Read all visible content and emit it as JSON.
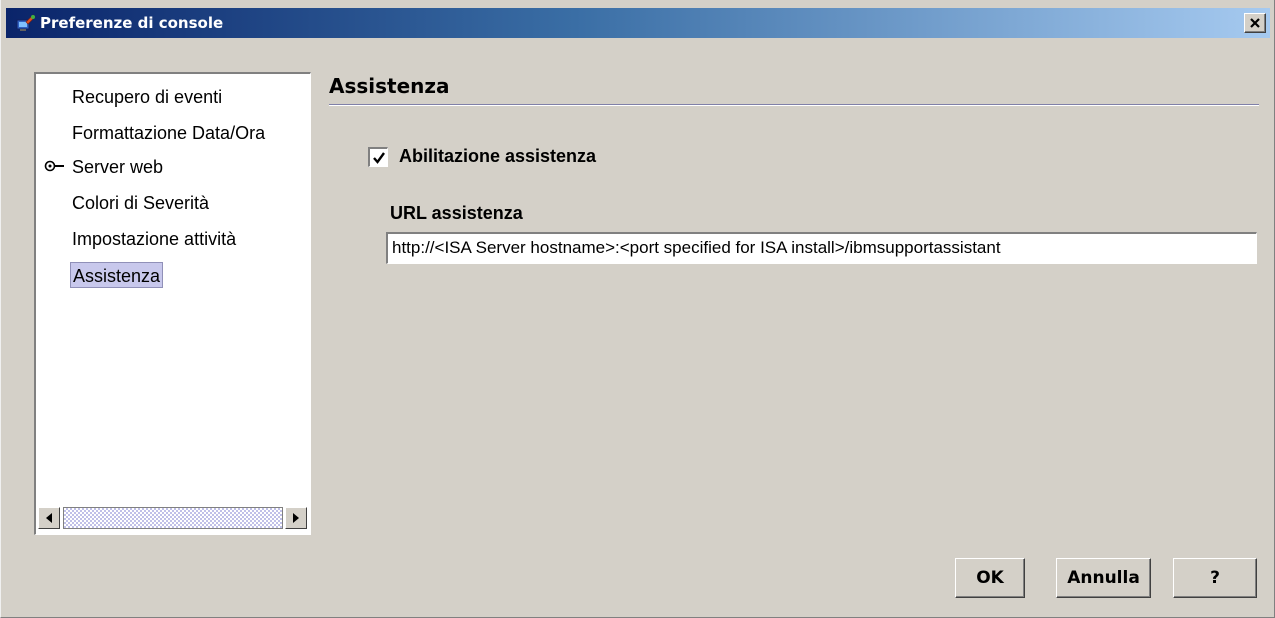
{
  "window": {
    "title": "Preferenze di console"
  },
  "nav": {
    "items": [
      {
        "label": "Recupero di eventi"
      },
      {
        "label": "Formattazione Data/Ora"
      },
      {
        "label": "Server web"
      },
      {
        "label": "Colori di Severità"
      },
      {
        "label": "Impostazione attività"
      },
      {
        "label": "Assistenza"
      }
    ],
    "selected": "Assistenza"
  },
  "main": {
    "section_title": "Assistenza",
    "enable_checkbox": {
      "label": "Abilitazione assistenza",
      "checked": true
    },
    "url_label": "URL assistenza",
    "url_value": "http://<ISA Server hostname>:<port specified for ISA install>/ibmsupportassistant"
  },
  "buttons": {
    "ok": "OK",
    "cancel": "Annulla",
    "help": "?"
  },
  "icons": {
    "app": "app-icon",
    "close": "close-icon",
    "server_marker": "key-icon",
    "scroll_left": "arrow-left-icon",
    "scroll_right": "arrow-right-icon",
    "checkmark": "checkmark-icon"
  },
  "colors": {
    "titlebar_start": "#0a246a",
    "titlebar_end": "#a6caf0",
    "selection": "#c8c8ec",
    "dialog_bg": "#d4d0c8"
  }
}
